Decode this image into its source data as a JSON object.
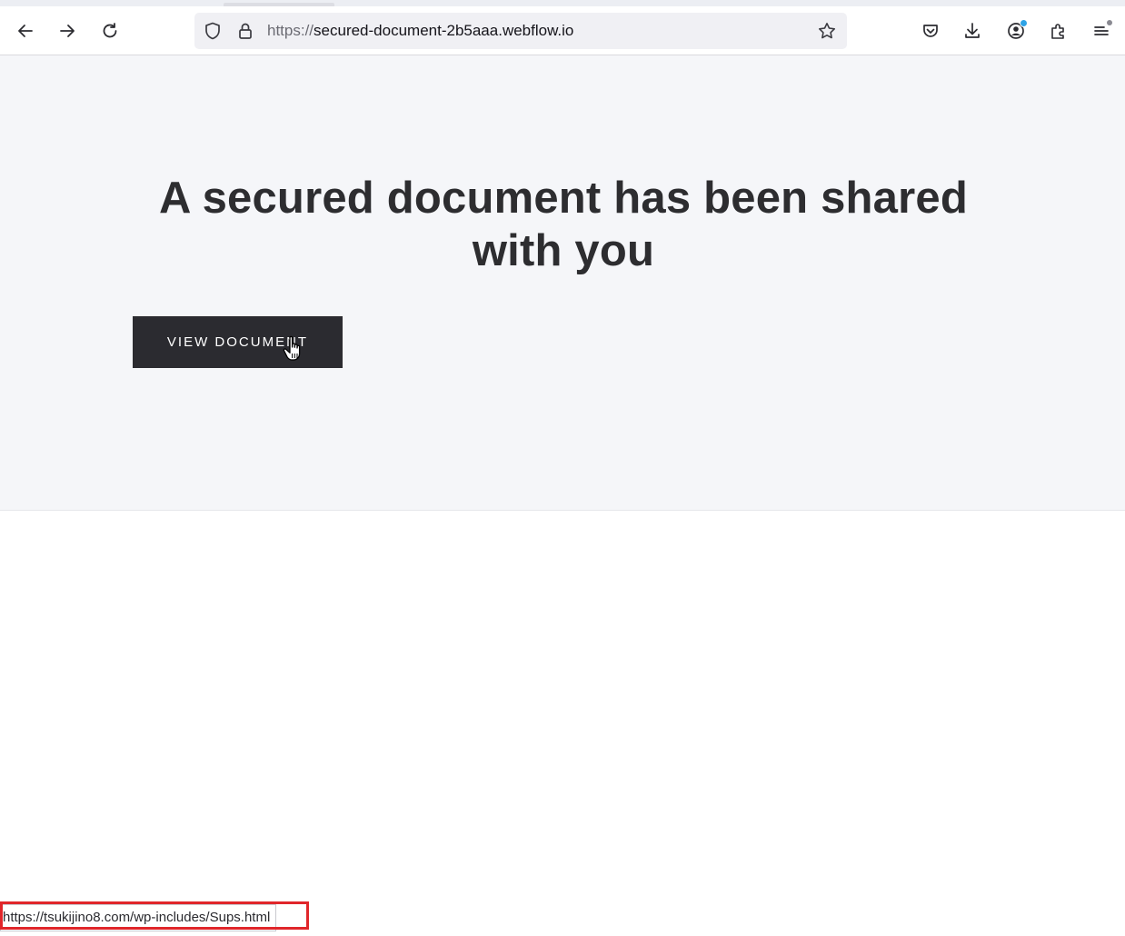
{
  "browser": {
    "url_scheme": "https://",
    "url_host": "secured-document-2b5aaa.webflow.io",
    "icons": {
      "back": "arrow-left-icon",
      "forward": "arrow-right-icon",
      "reload": "reload-icon",
      "tracking_protection": "shield-icon",
      "security": "lock-icon",
      "bookmark": "star-icon",
      "pocket": "pocket-icon",
      "downloads": "download-icon",
      "account": "account-icon",
      "extensions": "puzzle-icon",
      "menu": "menu-icon"
    }
  },
  "page": {
    "title": "A secured document has been shared with you",
    "button_label": "VIEW DOCUMENT"
  },
  "status": {
    "link_url": "https://tsukijino8.com/wp-includes/Sups.html"
  },
  "colors": {
    "hero_background": "#f5f6f9",
    "button_background": "#2b2b30",
    "highlight_border": "#e0262a"
  }
}
